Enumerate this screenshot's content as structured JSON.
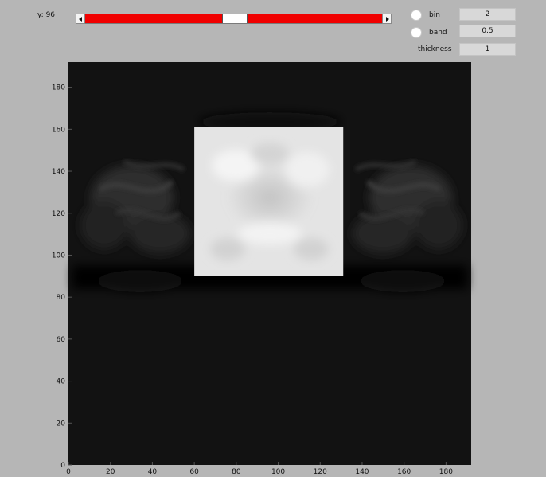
{
  "controls": {
    "y_label": "y: 96",
    "slider": {
      "min": 0,
      "max": 191,
      "value": 96
    },
    "bin_label": "bin",
    "band_label": "band",
    "thickness_label": "thickness",
    "bin_value": "2",
    "band_value": "0.5",
    "thickness_value": "1"
  },
  "plot": {
    "x_ticks": [
      "0",
      "20",
      "40",
      "60",
      "80",
      "100",
      "120",
      "140",
      "160",
      "180"
    ],
    "y_ticks": [
      "0",
      "20",
      "40",
      "60",
      "80",
      "100",
      "120",
      "140",
      "160",
      "180"
    ]
  },
  "chart_data": {
    "type": "heatmap",
    "colormap": "gray",
    "xlim": [
      0,
      192
    ],
    "ylim": [
      0,
      192
    ],
    "x_ticks": [
      0,
      20,
      40,
      60,
      80,
      100,
      120,
      140,
      160,
      180
    ],
    "y_ticks": [
      0,
      20,
      40,
      60,
      80,
      100,
      120,
      140,
      160,
      180
    ],
    "highlight_region": {
      "x": [
        60,
        131
      ],
      "y": [
        90,
        161
      ],
      "color": "#e4e4e4"
    },
    "background_color": "#121212"
  }
}
